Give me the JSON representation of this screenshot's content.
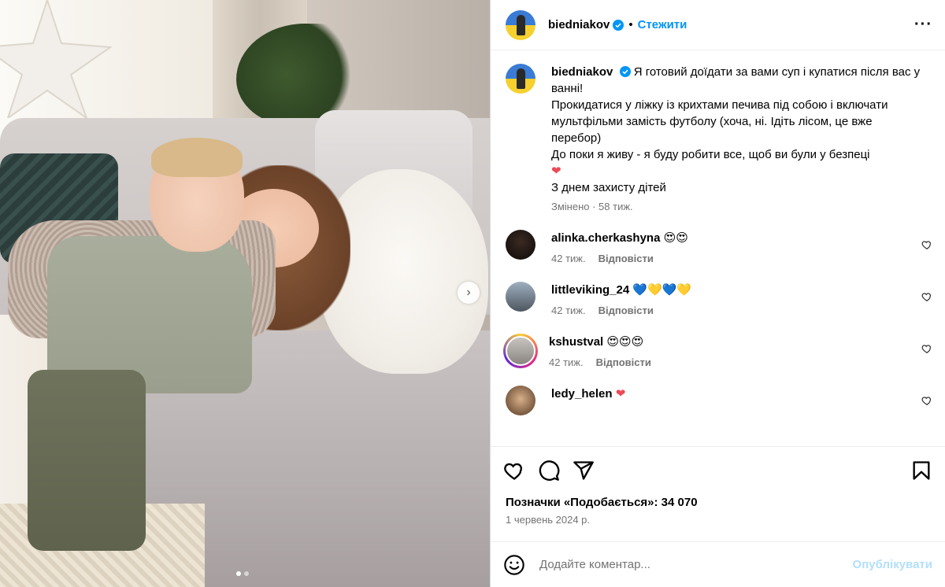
{
  "post": {
    "username": "biedniakov",
    "follow_label": "Стежити",
    "separator": "•",
    "more_icon": "more-horizontal-icon",
    "caption_lines": [
      "Я готовий доїдати за вами суп і купатися після вас у ванні!",
      "Прокидатися у ліжку із крихтами печива під собою і включати мультфільми замість футболу (хоча, ні. Ідіть лісом, це вже перебор)",
      "До поки я живу - я буду робити все, щоб ви були у безпеці",
      "❤",
      "З днем захисту дітей"
    ],
    "caption_meta": "Змінено · 58 тиж.",
    "comments": [
      {
        "user": "alinka.cherkashyna",
        "text": "😍😍",
        "time": "42 тиж.",
        "reply": "Відповісти"
      },
      {
        "user": "littleviking_24",
        "text": "💙💛💙💛",
        "time": "42 тиж.",
        "reply": "Відповісти"
      },
      {
        "user": "kshustval",
        "text": "😍😍😍",
        "time": "42 тиж.",
        "reply": "Відповісти"
      },
      {
        "user": "ledy_helen",
        "text": "❤",
        "time": "",
        "reply": ""
      }
    ],
    "likes": "Позначки «Подобається»: 34 070",
    "date": "1 червень 2024 р.",
    "comment_placeholder": "Додайте коментар...",
    "publish_label": "Опублікувати",
    "carousel": {
      "total": 2,
      "active": 1
    },
    "colors": {
      "link": "#0095f6",
      "publish_disabled": "#b2dffc",
      "heart": "#ed4956",
      "meta": "#737373"
    }
  }
}
